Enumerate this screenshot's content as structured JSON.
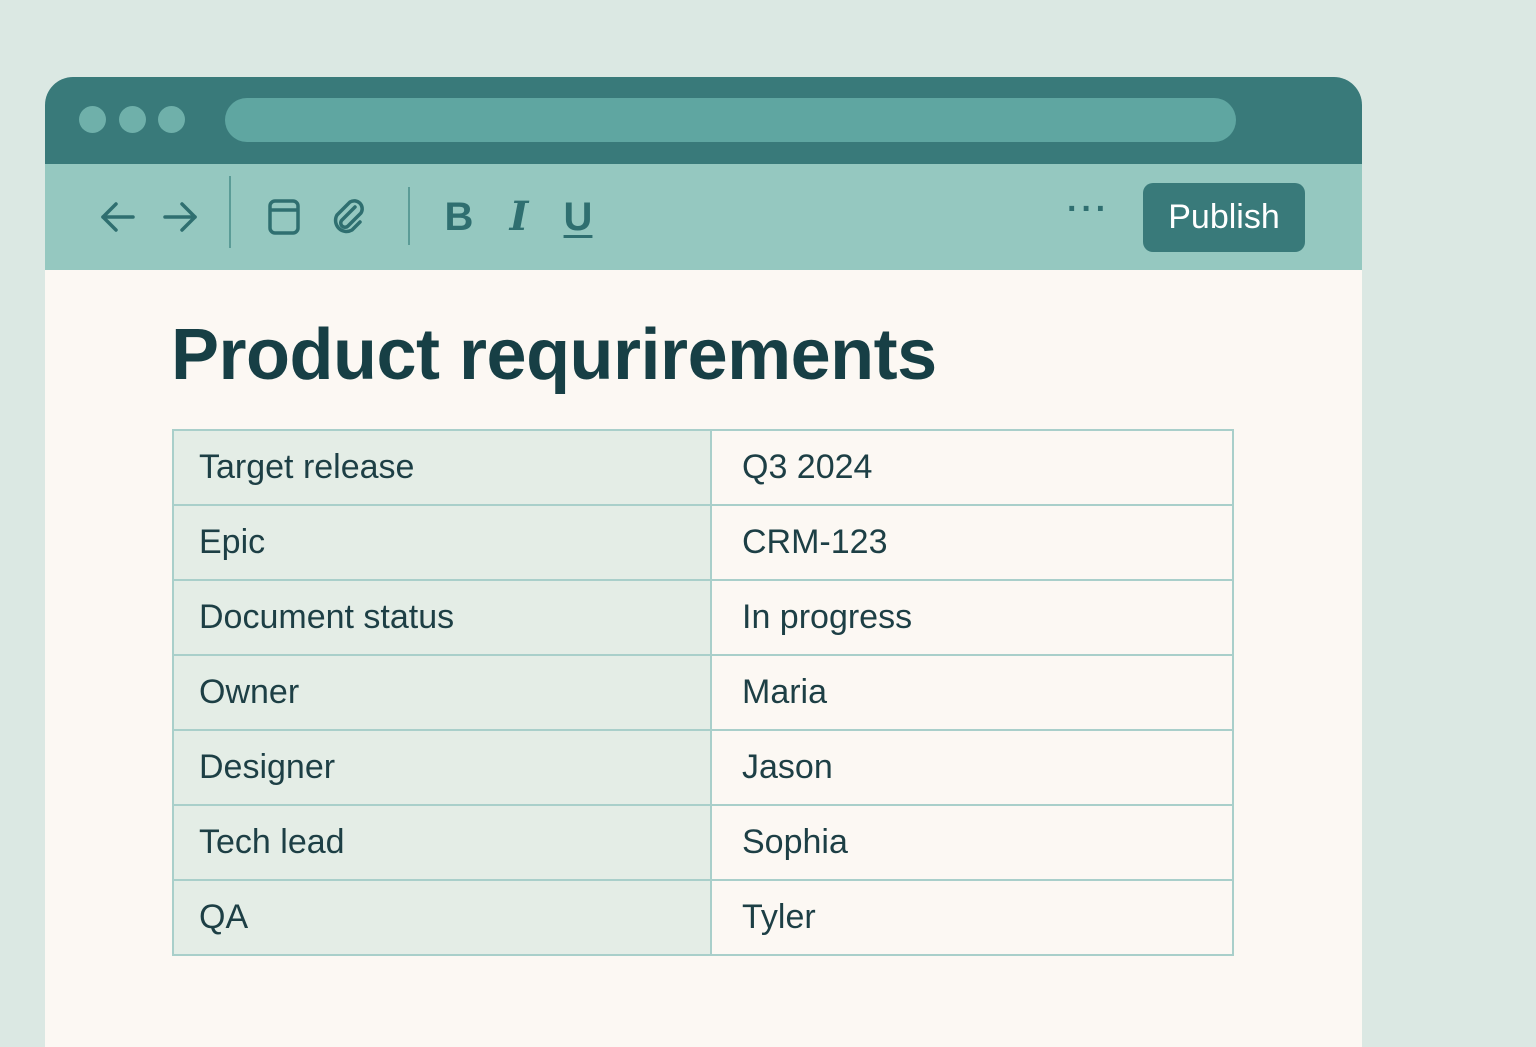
{
  "toolbar": {
    "back_icon": "arrow-left-icon",
    "forward_icon": "arrow-right-icon",
    "layout_icon": "layout-panel-icon",
    "attach_icon": "paperclip-icon",
    "bold_label": "B",
    "italic_label": "I",
    "underline_label": "U",
    "more_label": "···",
    "publish_label": "Publish"
  },
  "document": {
    "title": "Product requrirements",
    "properties": [
      {
        "key": "Target release",
        "value": "Q3 2024"
      },
      {
        "key": "Epic",
        "value": "CRM-123"
      },
      {
        "key": "Document status",
        "value": "In progress"
      },
      {
        "key": "Owner",
        "value": "Maria"
      },
      {
        "key": "Designer",
        "value": "Jason"
      },
      {
        "key": "Tech lead",
        "value": "Sophia"
      },
      {
        "key": "QA",
        "value": "Tyler"
      }
    ]
  },
  "colors": {
    "background": "#dbe8e3",
    "titlebar": "#397a7a",
    "toolbar": "#95c8c0",
    "accent": "#397a7a",
    "text": "#173f45"
  }
}
